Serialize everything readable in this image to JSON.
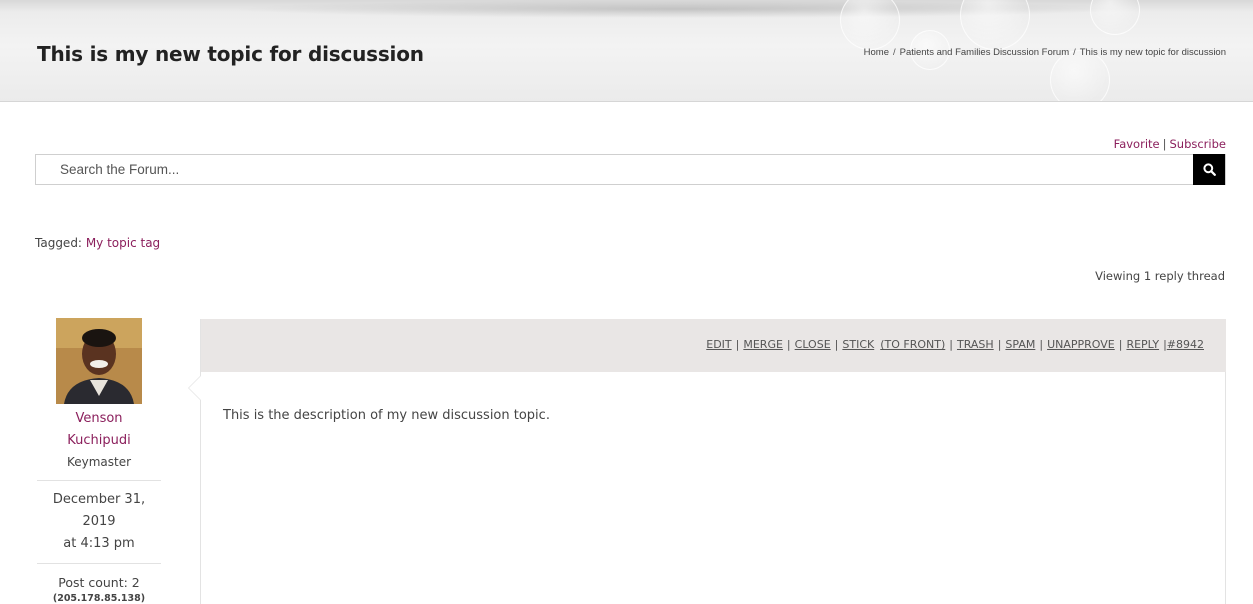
{
  "header": {
    "title": "This is my new topic for discussion",
    "breadcrumb": [
      "Home",
      "Patients and Families Discussion Forum",
      "This is my new topic for discussion"
    ],
    "breadcrumb_separator": "/"
  },
  "topic_actions": {
    "favorite": "Favorite",
    "separator": "|",
    "subscribe": "Subscribe"
  },
  "search": {
    "placeholder": "Search the Forum...",
    "value": "",
    "icon": "search-icon"
  },
  "tags": {
    "label": "Tagged:",
    "items": [
      "My topic tag"
    ]
  },
  "viewing": "Viewing 1 reply thread",
  "author": {
    "name_line1": "Venson",
    "name_line2": "Kuchipudi",
    "role": "Keymaster",
    "date": "December 31, 2019",
    "time": "at 4:13 pm",
    "post_count": "Post count: 2",
    "ip": "(205.178.85.138)"
  },
  "reply": {
    "admin_links": [
      "EDIT",
      "MERGE",
      "CLOSE",
      "STICK",
      "(TO FRONT)",
      "TRASH",
      "SPAM",
      "UNAPPROVE",
      "REPLY"
    ],
    "permalink": "#8942",
    "content": "This is the description of my new discussion topic."
  },
  "colors": {
    "link": "#8b1f5c",
    "reply_header_bg": "#e9e6e5",
    "search_button_bg": "#000000"
  }
}
